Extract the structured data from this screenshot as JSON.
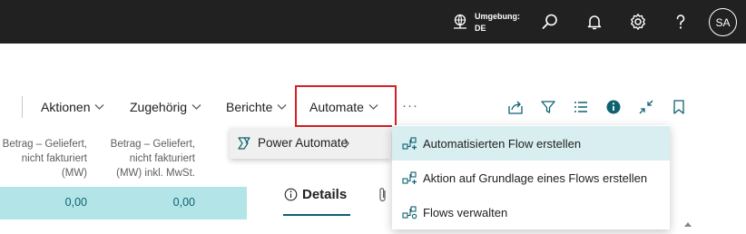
{
  "header": {
    "environment_label": "Umgebung:",
    "environment_value": "DE",
    "avatar_initials": "SA",
    "icons": [
      "environment-icon",
      "search-icon",
      "bell-icon",
      "gear-icon",
      "help-icon"
    ]
  },
  "actionbar": {
    "items": [
      {
        "label": "Aktionen"
      },
      {
        "label": "Zugehörig"
      },
      {
        "label": "Berichte"
      },
      {
        "label": "Automate"
      }
    ],
    "more_label": "···",
    "icons": [
      "share-icon",
      "filter-icon",
      "list-view-icon",
      "info-icon",
      "collapse-icon",
      "bookmark-icon"
    ]
  },
  "columns": [
    {
      "lines": [
        "Betrag – Geliefert,",
        "nicht fakturiert",
        "(MW)"
      ]
    },
    {
      "lines": [
        "Betrag – Geliefert,",
        "nicht fakturiert",
        "(MW) inkl. MwSt."
      ]
    }
  ],
  "row": {
    "values": [
      "0,00",
      "0,00"
    ]
  },
  "factbox": {
    "details_label": "Details"
  },
  "submenu": {
    "label": "Power Automate",
    "arrow": ">"
  },
  "flyout": {
    "items": [
      {
        "label": "Automatisierten Flow erstellen",
        "highlighted": true
      },
      {
        "label": "Aktion auf Grundlage eines Flows erstellen",
        "highlighted": false
      },
      {
        "label": "Flows verwalten",
        "highlighted": false
      }
    ]
  },
  "colors": {
    "topbar": "#212121",
    "accent": "#0e6270",
    "highlight_row": "#b3e5e8",
    "focus_box": "#d42027"
  }
}
